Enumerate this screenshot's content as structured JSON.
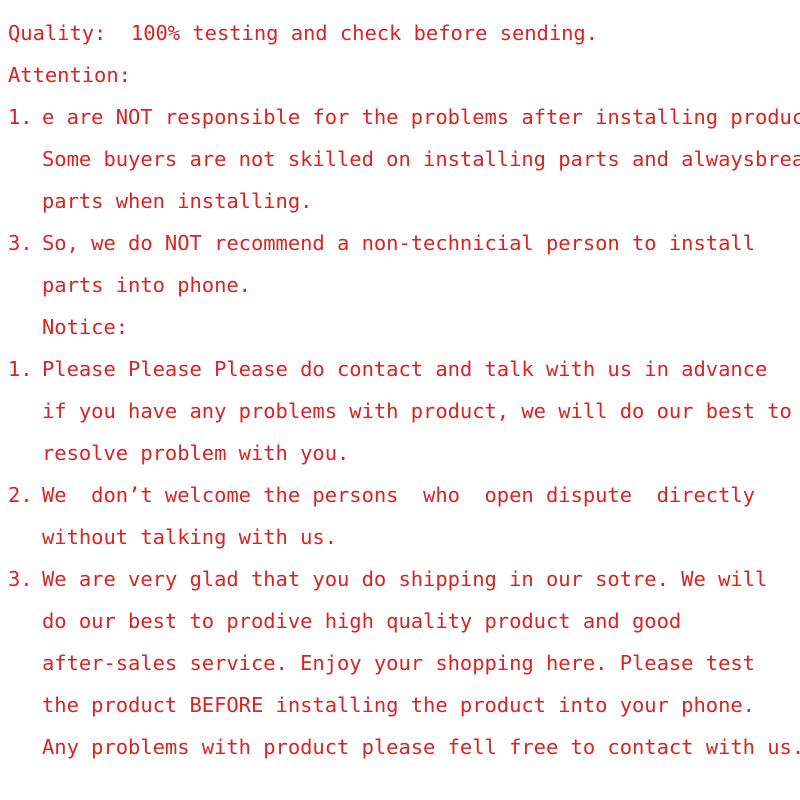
{
  "document": {
    "text_color": "#dd2222",
    "background_color": "#ffffff",
    "heading_quality": "Quality:  100% testing and check before sending.",
    "heading_attention": "Attention:",
    "heading_notice": "Notice:",
    "attention_items": [
      {
        "marker": "1.",
        "lines": [
          "e are NOT responsible for the problems after installing product",
          "Some buyers are not skilled on installing parts and alwaysbreak",
          "parts when installing."
        ]
      },
      {
        "marker": "3.",
        "lines": [
          "So, we do NOT recommend a non-technicial person to install",
          "parts into phone."
        ]
      }
    ],
    "notice_items": [
      {
        "marker": "1.",
        "lines": [
          "Please Please Please do contact and talk with us in advance",
          "if you have any problems with product, we will do our best to",
          "resolve problem with you."
        ]
      },
      {
        "marker": "2.",
        "lines": [
          "We  don’t welcome the persons  who  open dispute  directly",
          "without talking with us."
        ]
      },
      {
        "marker": "3.",
        "lines": [
          "We are very glad that you do shipping in our sotre. We will",
          "do our best to prodive high quality product and good",
          "after-sales service. Enjoy your shopping here. Please test",
          "the product BEFORE installing the product into your phone.",
          "Any problems with product please fell free to contact with us."
        ]
      }
    ]
  }
}
